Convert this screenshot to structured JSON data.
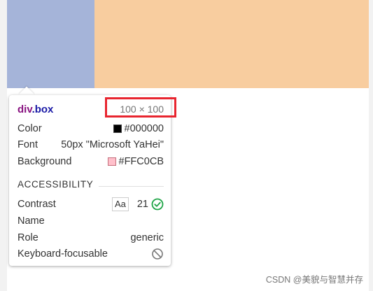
{
  "colors": {
    "padding": "#a5b4d9",
    "content": "#f8cd9f",
    "tag": "#881280",
    "class": "#1a1aa6",
    "highlight_border": "#e8252f",
    "check": "#1ea446"
  },
  "tooltip": {
    "tag": "div",
    "class": ".box",
    "size": "100 × 100",
    "properties": [
      {
        "label": "Color",
        "value": "#000000",
        "swatch": "#000000"
      },
      {
        "label": "Font",
        "value": "50px \"Microsoft YaHei\""
      },
      {
        "label": "Background",
        "value": "#FFC0CB",
        "swatch": "#FFC0CB"
      }
    ],
    "accessibility": {
      "title": "ACCESSIBILITY",
      "contrast_label": "Contrast",
      "contrast_chip": "Aa",
      "contrast_value": "21",
      "name_label": "Name",
      "role_label": "Role",
      "role_value": "generic",
      "focus_label": "Keyboard-focusable"
    }
  },
  "watermark": "CSDN @美貌与智慧并存",
  "icons": {
    "contrast_pass": "check-circle-icon",
    "not_focusable": "ban-icon"
  }
}
